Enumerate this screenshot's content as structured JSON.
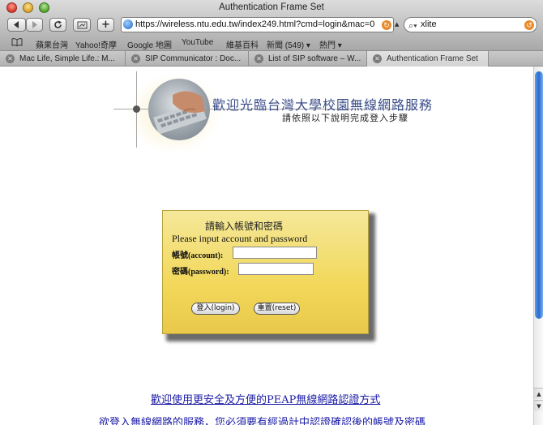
{
  "window": {
    "title": "Authentication Frame Set"
  },
  "toolbar": {
    "back_icon": "back-arrow-icon",
    "forward_icon": "forward-arrow-icon",
    "reload_icon": "reload-icon",
    "snapback_icon": "snapback-icon",
    "add_bookmark_label": "+",
    "url": "https://wireless.ntu.edu.tw/index249.html?cmd=login&mac=0",
    "search_value": "xlite"
  },
  "bookmarks": {
    "items": [
      "蘋果台灣",
      "Yahoo!奇摩",
      "Google 地圖",
      "YouTube",
      "維基百科",
      "新聞 (549) ▾",
      "熱門 ▾"
    ]
  },
  "tabs": [
    {
      "label": "Mac Life, Simple Life.: M..."
    },
    {
      "label": "SIP Communicator : Doc..."
    },
    {
      "label": "List of SIP software – W..."
    },
    {
      "label": "Authentication Frame Set"
    }
  ],
  "banner": {
    "title": "歡迎光臨台灣大學校園無線網路服務",
    "subtitle": "請依照以下說明完成登入步驟"
  },
  "login": {
    "title_zh": "請輸入帳號和密碼",
    "title_en": "Please input account and password",
    "account_label": "帳號(account):",
    "password_label": "密碼(password):",
    "account_value": "",
    "password_value": "",
    "login_button": "登入(login)",
    "reset_button": "重置(reset)"
  },
  "links": {
    "peap": "歡迎使用更安全及方便的PEAP無線網路認證方式",
    "notice": "欲登入無線網路的服務，您必須要有經過計中認證確認後的帳號及密碼"
  },
  "colors": {
    "panel": "#f2d85a",
    "link": "#1a1aa6",
    "banner_title": "#3a4d8a"
  }
}
